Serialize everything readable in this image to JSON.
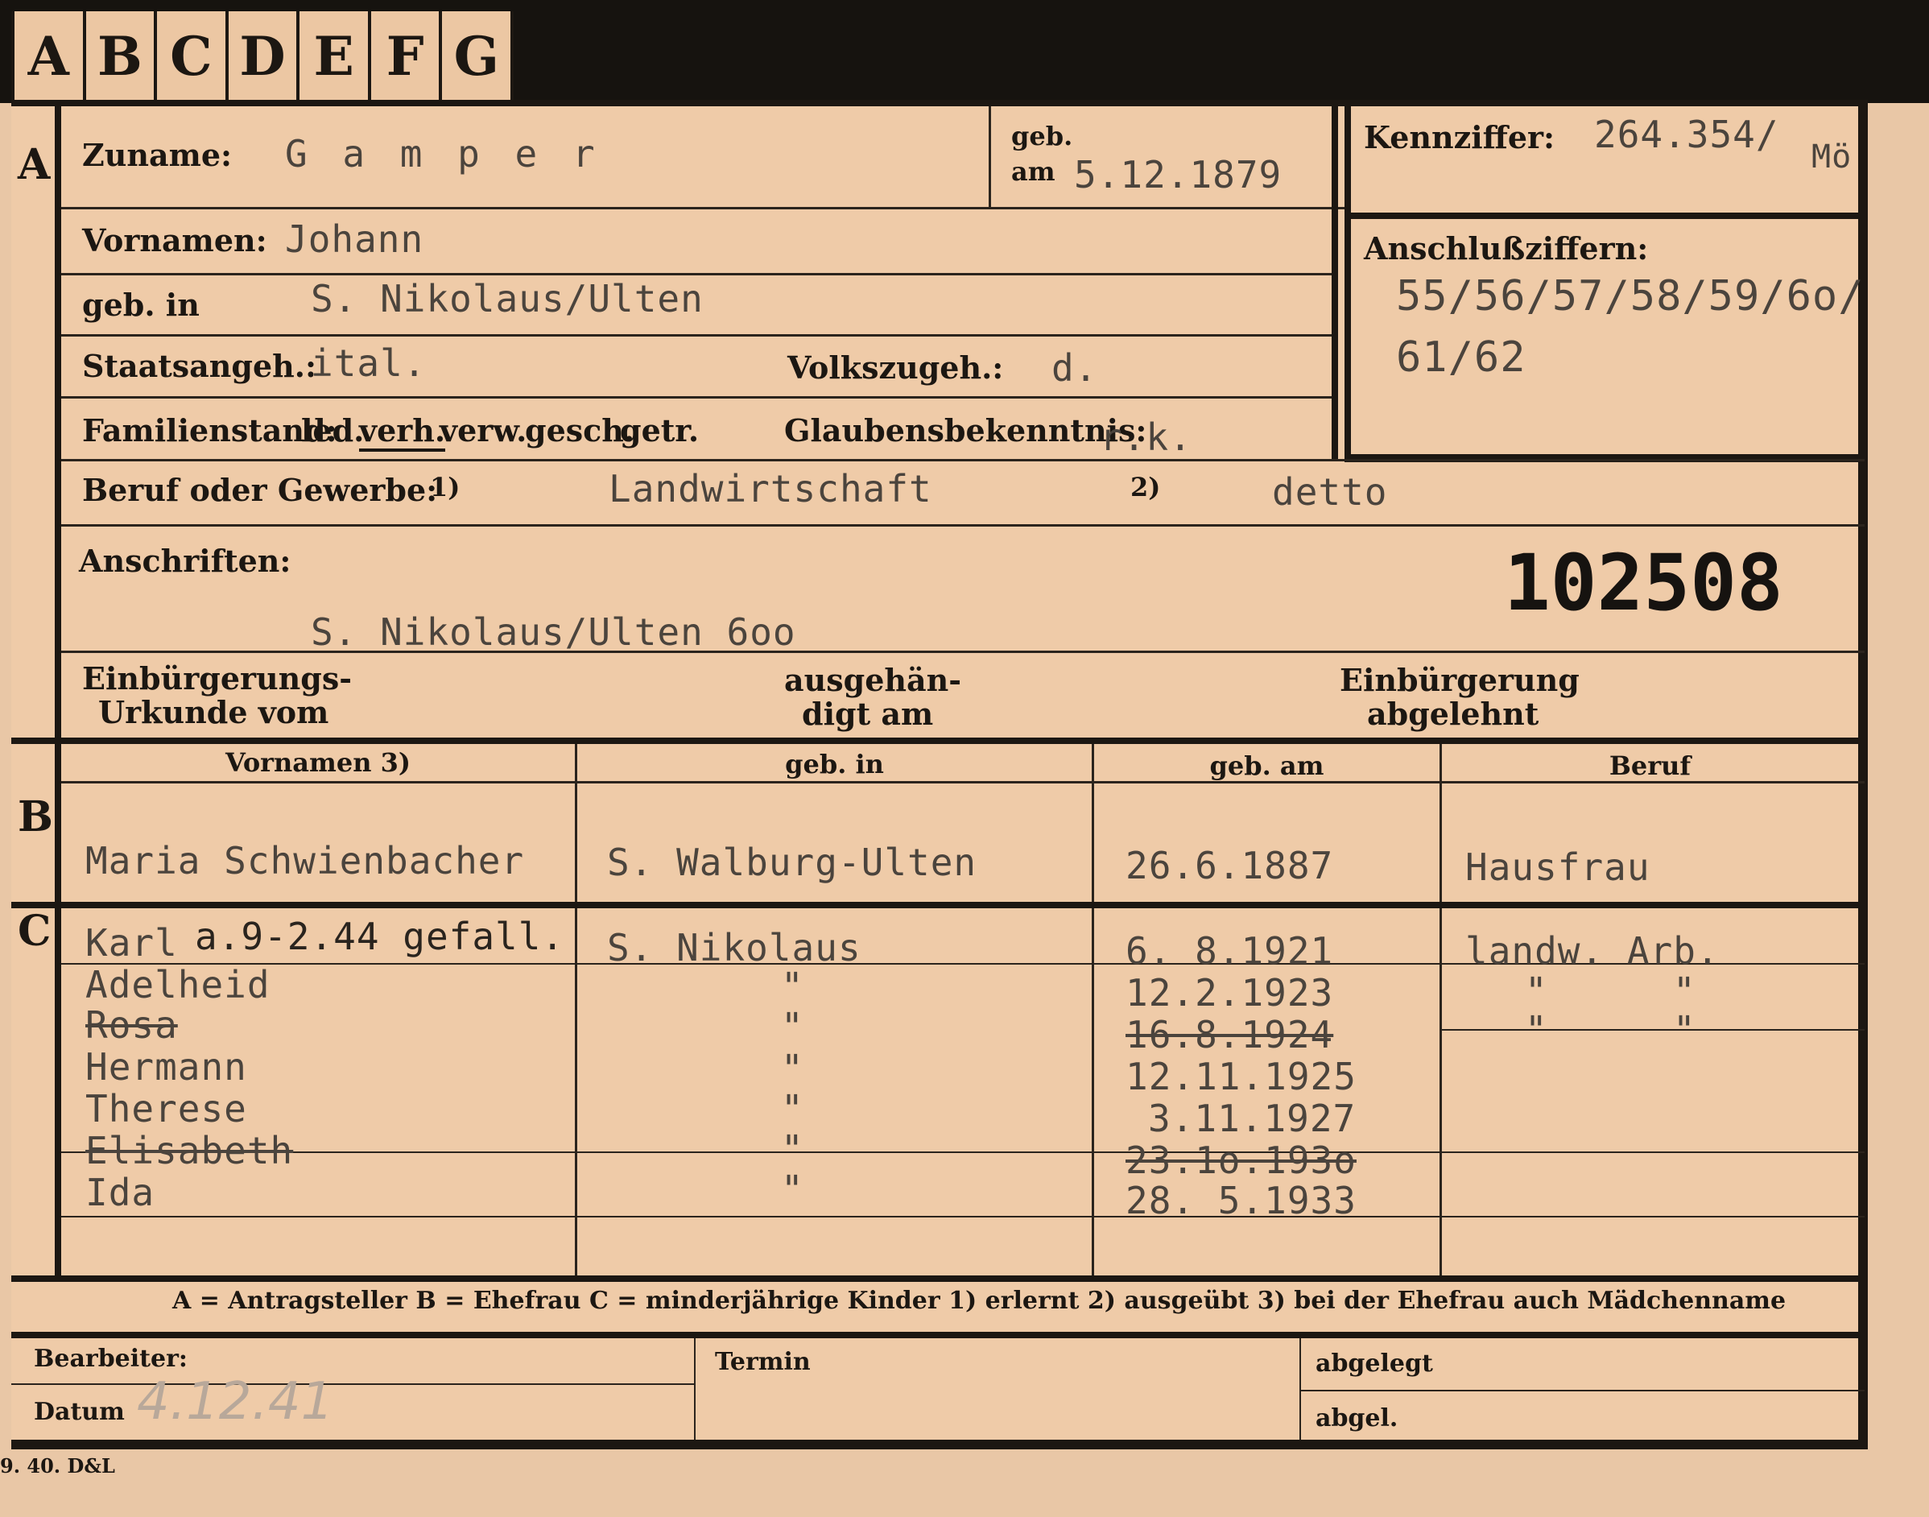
{
  "tabs": [
    "A",
    "B",
    "C",
    "D",
    "E",
    "F",
    "G"
  ],
  "sections": {
    "a": "A",
    "b": "B",
    "c": "C"
  },
  "applicant": {
    "zuname_label": "Zuname:",
    "zuname": "G a m p e r",
    "geb_label": "geb.",
    "am_label": "am",
    "geb_am": "5.12.1879",
    "kennziffer_label": "Kennziffer:",
    "kennziffer": "264.354/",
    "kennziffer_suffix": "Mö",
    "vornamen_label": "Vornamen:",
    "vornamen": "Johann",
    "gebin_label": "geb. in",
    "gebin": "S. Nikolaus/Ulten",
    "anschluss_label": "Anschlußziffern:",
    "anschluss_1": "55/56/57/58/59/6o/",
    "anschluss_2": "61/62",
    "staat_label": "Staatsangeh.:",
    "staat": "ital.",
    "volk_label": "Volkszugeh.:",
    "volk": "d.",
    "familie_label": "Familienstand:",
    "familie_options": [
      "led.",
      "verh.",
      "verw.",
      "gesch.",
      "getr."
    ],
    "glaube_label": "Glaubensbekenntnis:",
    "glaube": "r.k.",
    "beruf_label": "Beruf oder Gewerbe:",
    "beruf_m1": "1)",
    "beruf_1": "Landwirtschaft",
    "beruf_m2": "2)",
    "beruf_2": "detto",
    "anschrift_label": "Anschriften:",
    "anschrift": "S. Nikolaus/Ulten 6oo",
    "number": "102508",
    "einb_urkunde": [
      "Einbürgerungs-",
      "Urkunde vom"
    ],
    "ausgehaendigt": [
      "ausgehän-",
      "digt am"
    ],
    "einb_abgelehnt": [
      "Einbürgerung",
      "abgelehnt"
    ]
  },
  "spouse": {
    "headers": [
      "Vornamen 3)",
      "geb. in",
      "geb. am",
      "Beruf"
    ],
    "row": [
      "Maria Schwienbacher",
      "S. Walburg-Ulten",
      "26.6.1887",
      "Hausfrau"
    ]
  },
  "children": [
    {
      "name": "Karl",
      "note": "a.9-2.44 gefall.",
      "place": "S. Nikolaus",
      "date": "6. 8.1921",
      "job": "landw. Arb."
    },
    {
      "name": "Adelheid",
      "place": "\"",
      "date": "12.2.1923",
      "job": [
        "\"",
        "\""
      ]
    },
    {
      "name": "Rosa",
      "place": "\"",
      "date": "16.8.1924",
      "job": [
        "\"",
        "\""
      ]
    },
    {
      "name": "Hermann",
      "place": "\"",
      "date": "12.11.1925"
    },
    {
      "name": "Therese",
      "place": "\"",
      "date": "3.11.1927"
    },
    {
      "name": "Elisabeth",
      "place": "\"",
      "date": "23.1o.193o"
    },
    {
      "name": "Ida",
      "place": "\"",
      "date": "28. 5.1933"
    }
  ],
  "legend": "A = Antragsteller   B = Ehefrau   C = minderjährige Kinder   1) erlernt   2) ausgeübt   3) bei der Ehefrau auch Mädchenname",
  "footer": {
    "bearbeiter": "Bearbeiter:",
    "datum": "Datum",
    "datum_value": "4.12.41",
    "termin": "Termin",
    "abgelegt": "abgelegt",
    "abgelegt2": "abgel.",
    "print_code": "9. 40. D&L"
  }
}
